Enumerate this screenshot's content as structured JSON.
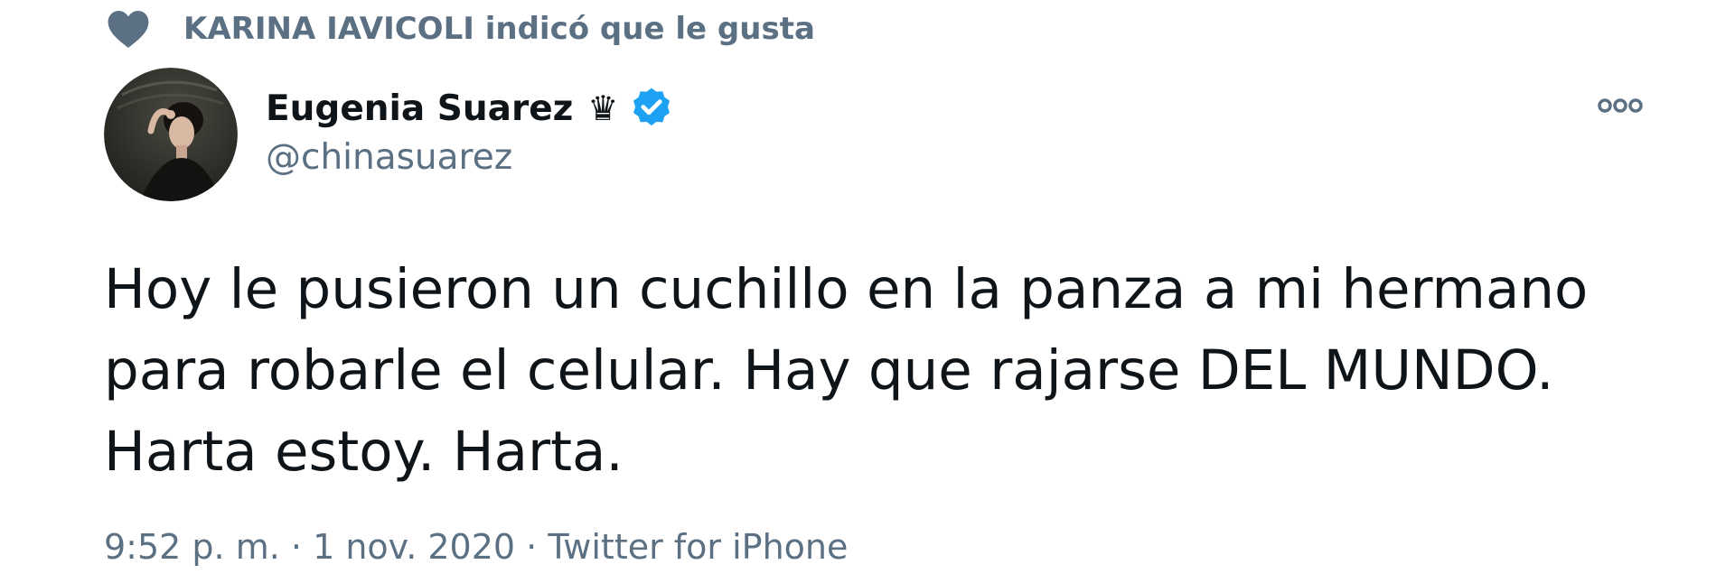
{
  "social_context": {
    "icon": "heart-icon",
    "text": "KARINA IAVICOLI indicó que le gusta"
  },
  "author": {
    "display_name": "Eugenia Suarez",
    "crown": "♛",
    "verified_icon": "verified-badge-icon",
    "handle": "@chinasuarez"
  },
  "more_button": {
    "icon": "more-options-icon"
  },
  "tweet": {
    "text": "Hoy le pusieron un cuchillo en la panza a mi hermano\npara robarle el celular. Hay que rajarse DEL MUNDO.\nHarta estoy. Harta."
  },
  "meta": {
    "time": "9:52 p. m.",
    "separator": "·",
    "date": "1 nov. 2020",
    "source": "Twitter for iPhone"
  },
  "colors": {
    "text_primary": "#0f1419",
    "text_secondary": "#5b7083",
    "verified_blue": "#1da1f2"
  }
}
